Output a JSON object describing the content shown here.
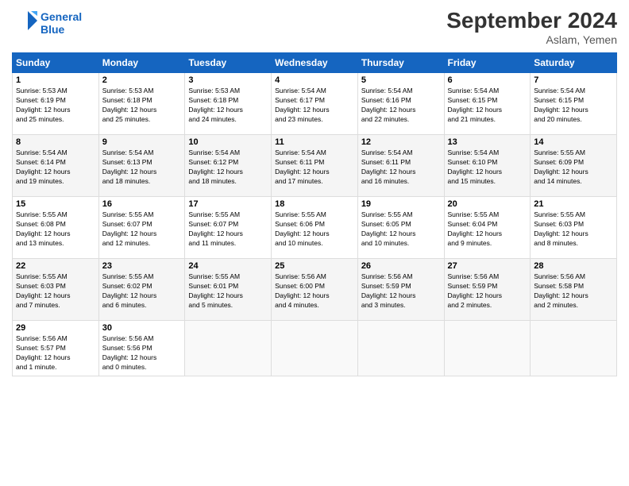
{
  "header": {
    "logo_line1": "General",
    "logo_line2": "Blue",
    "month_title": "September 2024",
    "location": "Aslam, Yemen"
  },
  "days_of_week": [
    "Sunday",
    "Monday",
    "Tuesday",
    "Wednesday",
    "Thursday",
    "Friday",
    "Saturday"
  ],
  "weeks": [
    [
      {
        "day": "1",
        "lines": [
          "Sunrise: 5:53 AM",
          "Sunset: 6:19 PM",
          "Daylight: 12 hours",
          "and 25 minutes."
        ]
      },
      {
        "day": "2",
        "lines": [
          "Sunrise: 5:53 AM",
          "Sunset: 6:18 PM",
          "Daylight: 12 hours",
          "and 25 minutes."
        ]
      },
      {
        "day": "3",
        "lines": [
          "Sunrise: 5:53 AM",
          "Sunset: 6:18 PM",
          "Daylight: 12 hours",
          "and 24 minutes."
        ]
      },
      {
        "day": "4",
        "lines": [
          "Sunrise: 5:54 AM",
          "Sunset: 6:17 PM",
          "Daylight: 12 hours",
          "and 23 minutes."
        ]
      },
      {
        "day": "5",
        "lines": [
          "Sunrise: 5:54 AM",
          "Sunset: 6:16 PM",
          "Daylight: 12 hours",
          "and 22 minutes."
        ]
      },
      {
        "day": "6",
        "lines": [
          "Sunrise: 5:54 AM",
          "Sunset: 6:15 PM",
          "Daylight: 12 hours",
          "and 21 minutes."
        ]
      },
      {
        "day": "7",
        "lines": [
          "Sunrise: 5:54 AM",
          "Sunset: 6:15 PM",
          "Daylight: 12 hours",
          "and 20 minutes."
        ]
      }
    ],
    [
      {
        "day": "8",
        "lines": [
          "Sunrise: 5:54 AM",
          "Sunset: 6:14 PM",
          "Daylight: 12 hours",
          "and 19 minutes."
        ]
      },
      {
        "day": "9",
        "lines": [
          "Sunrise: 5:54 AM",
          "Sunset: 6:13 PM",
          "Daylight: 12 hours",
          "and 18 minutes."
        ]
      },
      {
        "day": "10",
        "lines": [
          "Sunrise: 5:54 AM",
          "Sunset: 6:12 PM",
          "Daylight: 12 hours",
          "and 18 minutes."
        ]
      },
      {
        "day": "11",
        "lines": [
          "Sunrise: 5:54 AM",
          "Sunset: 6:11 PM",
          "Daylight: 12 hours",
          "and 17 minutes."
        ]
      },
      {
        "day": "12",
        "lines": [
          "Sunrise: 5:54 AM",
          "Sunset: 6:11 PM",
          "Daylight: 12 hours",
          "and 16 minutes."
        ]
      },
      {
        "day": "13",
        "lines": [
          "Sunrise: 5:54 AM",
          "Sunset: 6:10 PM",
          "Daylight: 12 hours",
          "and 15 minutes."
        ]
      },
      {
        "day": "14",
        "lines": [
          "Sunrise: 5:55 AM",
          "Sunset: 6:09 PM",
          "Daylight: 12 hours",
          "and 14 minutes."
        ]
      }
    ],
    [
      {
        "day": "15",
        "lines": [
          "Sunrise: 5:55 AM",
          "Sunset: 6:08 PM",
          "Daylight: 12 hours",
          "and 13 minutes."
        ]
      },
      {
        "day": "16",
        "lines": [
          "Sunrise: 5:55 AM",
          "Sunset: 6:07 PM",
          "Daylight: 12 hours",
          "and 12 minutes."
        ]
      },
      {
        "day": "17",
        "lines": [
          "Sunrise: 5:55 AM",
          "Sunset: 6:07 PM",
          "Daylight: 12 hours",
          "and 11 minutes."
        ]
      },
      {
        "day": "18",
        "lines": [
          "Sunrise: 5:55 AM",
          "Sunset: 6:06 PM",
          "Daylight: 12 hours",
          "and 10 minutes."
        ]
      },
      {
        "day": "19",
        "lines": [
          "Sunrise: 5:55 AM",
          "Sunset: 6:05 PM",
          "Daylight: 12 hours",
          "and 10 minutes."
        ]
      },
      {
        "day": "20",
        "lines": [
          "Sunrise: 5:55 AM",
          "Sunset: 6:04 PM",
          "Daylight: 12 hours",
          "and 9 minutes."
        ]
      },
      {
        "day": "21",
        "lines": [
          "Sunrise: 5:55 AM",
          "Sunset: 6:03 PM",
          "Daylight: 12 hours",
          "and 8 minutes."
        ]
      }
    ],
    [
      {
        "day": "22",
        "lines": [
          "Sunrise: 5:55 AM",
          "Sunset: 6:03 PM",
          "Daylight: 12 hours",
          "and 7 minutes."
        ]
      },
      {
        "day": "23",
        "lines": [
          "Sunrise: 5:55 AM",
          "Sunset: 6:02 PM",
          "Daylight: 12 hours",
          "and 6 minutes."
        ]
      },
      {
        "day": "24",
        "lines": [
          "Sunrise: 5:55 AM",
          "Sunset: 6:01 PM",
          "Daylight: 12 hours",
          "and 5 minutes."
        ]
      },
      {
        "day": "25",
        "lines": [
          "Sunrise: 5:56 AM",
          "Sunset: 6:00 PM",
          "Daylight: 12 hours",
          "and 4 minutes."
        ]
      },
      {
        "day": "26",
        "lines": [
          "Sunrise: 5:56 AM",
          "Sunset: 5:59 PM",
          "Daylight: 12 hours",
          "and 3 minutes."
        ]
      },
      {
        "day": "27",
        "lines": [
          "Sunrise: 5:56 AM",
          "Sunset: 5:59 PM",
          "Daylight: 12 hours",
          "and 2 minutes."
        ]
      },
      {
        "day": "28",
        "lines": [
          "Sunrise: 5:56 AM",
          "Sunset: 5:58 PM",
          "Daylight: 12 hours",
          "and 2 minutes."
        ]
      }
    ],
    [
      {
        "day": "29",
        "lines": [
          "Sunrise: 5:56 AM",
          "Sunset: 5:57 PM",
          "Daylight: 12 hours",
          "and 1 minute."
        ]
      },
      {
        "day": "30",
        "lines": [
          "Sunrise: 5:56 AM",
          "Sunset: 5:56 PM",
          "Daylight: 12 hours",
          "and 0 minutes."
        ]
      },
      {
        "day": "",
        "lines": []
      },
      {
        "day": "",
        "lines": []
      },
      {
        "day": "",
        "lines": []
      },
      {
        "day": "",
        "lines": []
      },
      {
        "day": "",
        "lines": []
      }
    ]
  ]
}
